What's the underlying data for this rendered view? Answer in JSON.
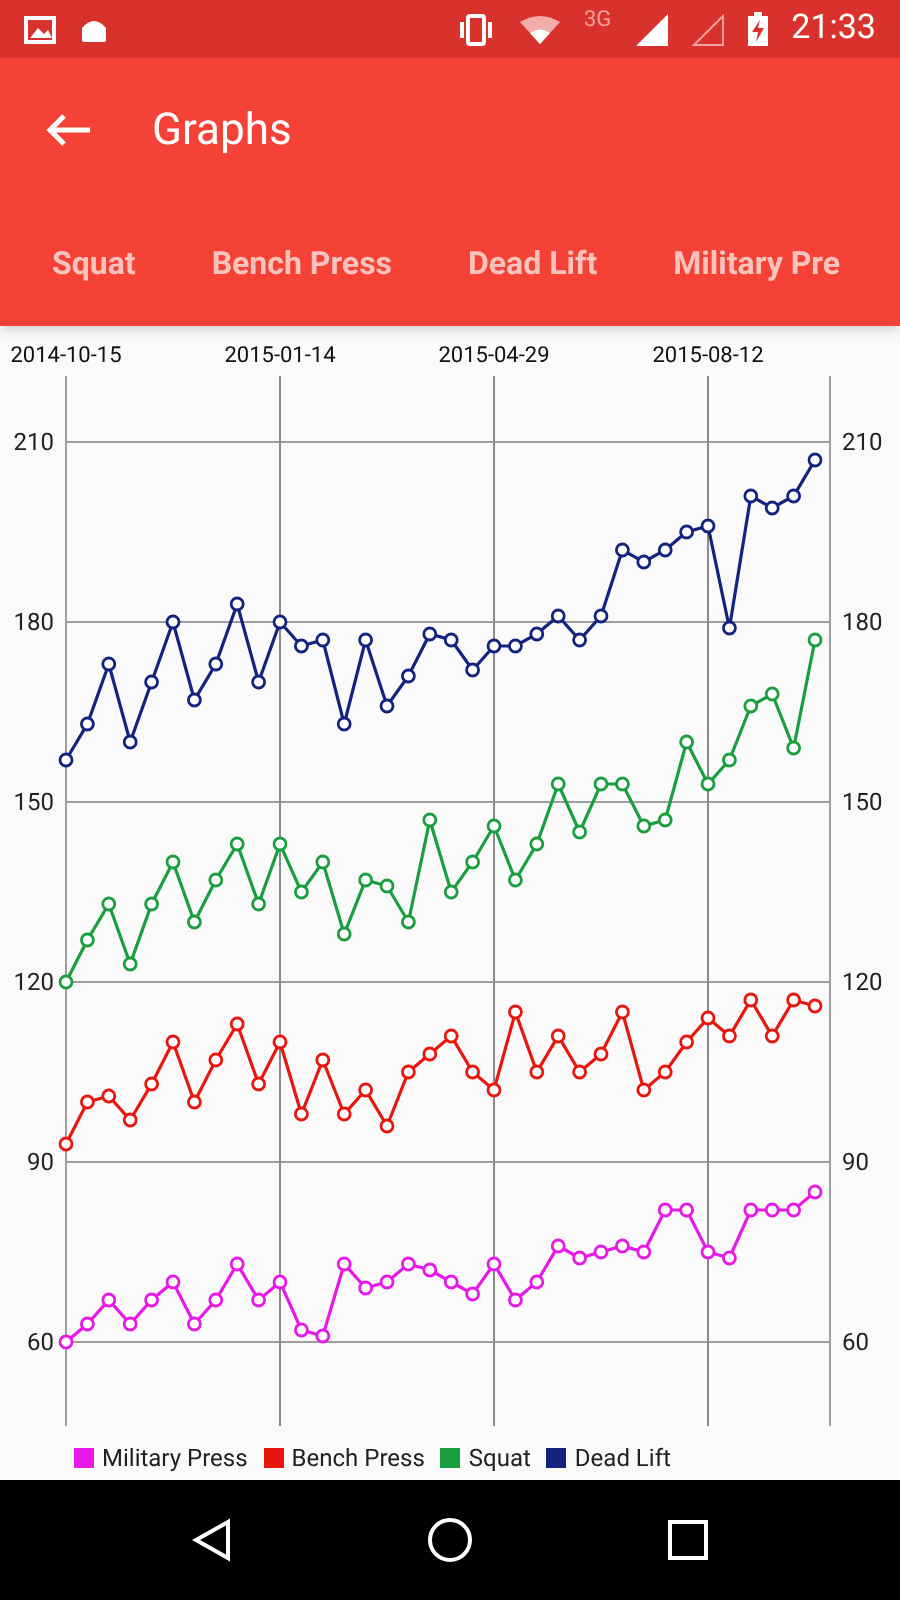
{
  "status_bar": {
    "network": "3G",
    "time": "21:33"
  },
  "toolbar": {
    "title": "Graphs"
  },
  "tabs": [
    {
      "label": "Squat"
    },
    {
      "label": "Bench Press"
    },
    {
      "label": "Dead Lift"
    },
    {
      "label": "Military Pre"
    }
  ],
  "chart_data": {
    "type": "line",
    "grid": true,
    "ylim": [
      46,
      221
    ],
    "categories": [
      "2014-10-15",
      null,
      null,
      null,
      null,
      null,
      null,
      null,
      null,
      null,
      "2015-01-14",
      null,
      null,
      null,
      null,
      null,
      null,
      null,
      null,
      null,
      "2015-04-29",
      null,
      null,
      null,
      null,
      null,
      null,
      null,
      null,
      null,
      "2015-08-12",
      null,
      null,
      null,
      null,
      null
    ],
    "yticks": [
      {
        "value": 60,
        "label": "60"
      },
      {
        "value": 90,
        "label": "90"
      },
      {
        "value": 120,
        "label": "120"
      },
      {
        "value": 150,
        "label": "150"
      },
      {
        "value": 180,
        "label": "180"
      },
      {
        "value": 210,
        "label": "210"
      }
    ],
    "series": [
      {
        "name": "Military Press",
        "color": "#e619e6",
        "marker": "o",
        "values": [
          60,
          63,
          67,
          63,
          67,
          70,
          63,
          67,
          73,
          67,
          70,
          62,
          61,
          73,
          69,
          70,
          73,
          72,
          70,
          68,
          73,
          67,
          70,
          76,
          74,
          75,
          76,
          75,
          82,
          82,
          75,
          74,
          82,
          82,
          82,
          85
        ]
      },
      {
        "name": "Bench Press",
        "color": "#e8160c",
        "marker": "o",
        "values": [
          93,
          100,
          101,
          97,
          103,
          110,
          100,
          107,
          113,
          103,
          110,
          98,
          107,
          98,
          102,
          96,
          105,
          108,
          111,
          105,
          102,
          115,
          105,
          111,
          105,
          108,
          115,
          102,
          105,
          110,
          114,
          111,
          117,
          111,
          117,
          116
        ]
      },
      {
        "name": "Squat",
        "color": "#1b9e3e",
        "marker": "o",
        "values": [
          120,
          127,
          133,
          123,
          133,
          140,
          130,
          137,
          143,
          133,
          143,
          135,
          140,
          128,
          137,
          136,
          130,
          147,
          135,
          140,
          146,
          137,
          143,
          153,
          145,
          153,
          153,
          146,
          147,
          160,
          153,
          157,
          166,
          168,
          159,
          177
        ]
      },
      {
        "name": "Dead Lift",
        "color": "#13247e",
        "marker": "o",
        "values": [
          157,
          163,
          173,
          160,
          170,
          180,
          167,
          173,
          183,
          170,
          180,
          176,
          177,
          163,
          177,
          166,
          171,
          178,
          177,
          172,
          176,
          176,
          178,
          181,
          177,
          181,
          192,
          190,
          192,
          195,
          196,
          179,
          201,
          199,
          201,
          207
        ]
      }
    ]
  }
}
